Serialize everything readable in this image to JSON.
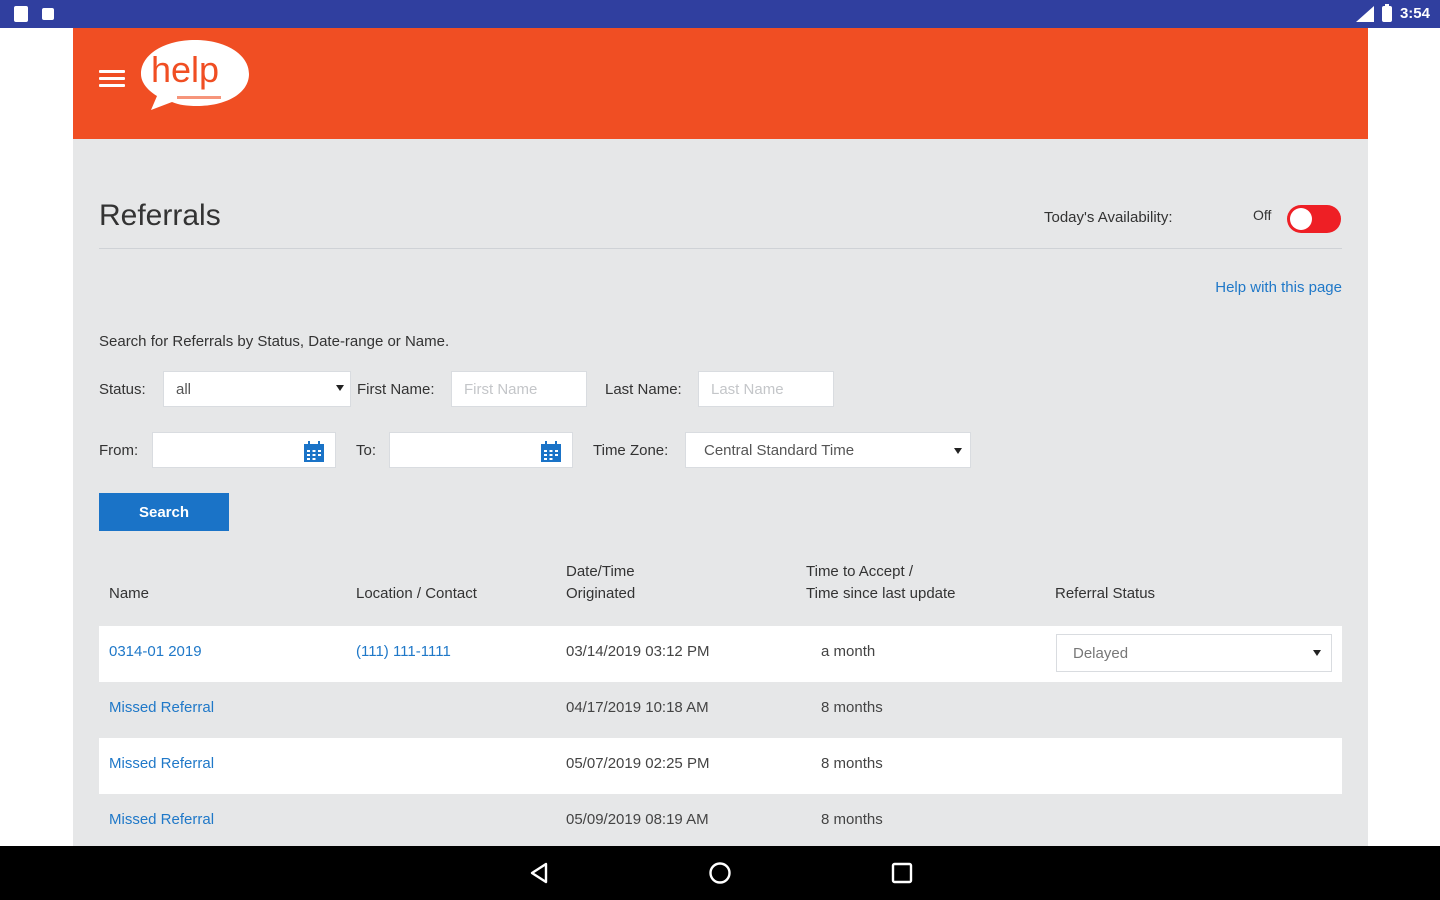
{
  "status_bar": {
    "time": "3:54"
  },
  "header": {
    "logo_text": "help"
  },
  "page": {
    "title": "Referrals",
    "availability_label": "Today's Availability:",
    "availability_state": "Off",
    "help_link": "Help with this page",
    "instructions": "Search for Referrals by Status, Date-range or Name."
  },
  "filters": {
    "status_label": "Status:",
    "status_value": "all",
    "first_name_label": "First Name:",
    "first_name_placeholder": "First Name",
    "last_name_label": "Last Name:",
    "last_name_placeholder": "Last Name",
    "from_label": "From:",
    "to_label": "To:",
    "timezone_label": "Time Zone:",
    "timezone_value": "Central Standard Time",
    "search_button": "Search"
  },
  "table": {
    "headers": {
      "name": "Name",
      "location": "Location / Contact",
      "datetime_line1": "Date/Time",
      "datetime_line2": "Originated",
      "accept_line1": "Time to Accept /",
      "accept_line2": "Time since last update",
      "status": "Referral Status"
    },
    "rows": [
      {
        "name": "0314-01 2019",
        "contact": "(111) 111-1111",
        "datetime": "03/14/2019 03:12 PM",
        "elapsed": "a month",
        "status": "Delayed"
      },
      {
        "name": "Missed Referral",
        "contact": "",
        "datetime": "04/17/2019 10:18 AM",
        "elapsed": "8 months",
        "status": ""
      },
      {
        "name": "Missed Referral",
        "contact": "",
        "datetime": "05/07/2019 02:25 PM",
        "elapsed": "8 months",
        "status": ""
      },
      {
        "name": "Missed Referral",
        "contact": "",
        "datetime": "05/09/2019 08:19 AM",
        "elapsed": "8 months",
        "status": ""
      }
    ]
  },
  "colors": {
    "brand": "#f04e23",
    "primary": "#1a73c7",
    "toggle": "#ee1f25",
    "status_bar": "#303f9f"
  }
}
